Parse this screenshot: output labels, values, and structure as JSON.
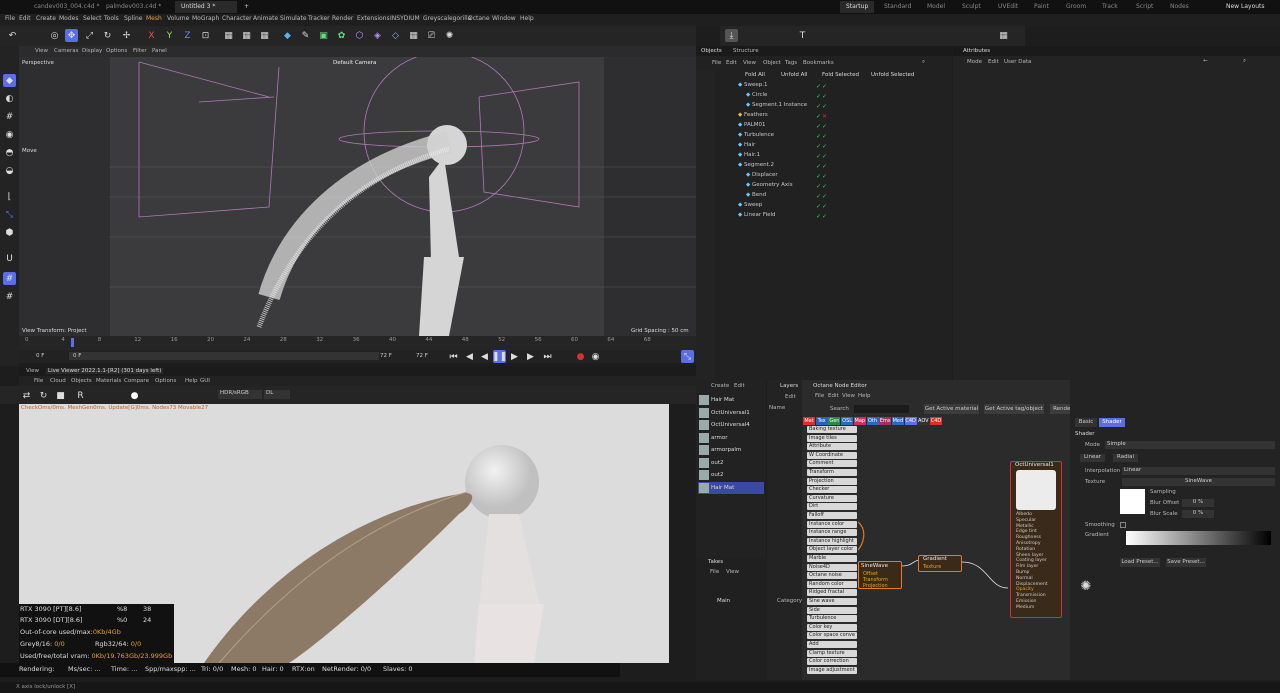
{
  "tabs": [
    "candev003_004.c4d *",
    "palmdev003.c4d *",
    "Untitled 3 *"
  ],
  "layouts": [
    "Startup",
    "Standard",
    "Model",
    "Sculpt",
    "UVEdit",
    "Paint",
    "Groom",
    "Track",
    "Script",
    "Nodes",
    "New Layouts"
  ],
  "menu": [
    "File",
    "Edit",
    "Create",
    "Modes",
    "Select",
    "Tools",
    "Spline",
    "Mesh",
    "Volume",
    "MoGraph",
    "Character",
    "Animate",
    "Simulate",
    "Tracker",
    "Render",
    "Extensions",
    "INSYDIUM",
    "Greyscalegorilla",
    "Octane",
    "Window",
    "Help"
  ],
  "viewport": {
    "menu": [
      "View",
      "Cameras",
      "Display",
      "Options",
      "Filter",
      "Panel"
    ],
    "label": "Perspective",
    "camera": "Default Camera",
    "move": "Move",
    "transform": "View Transform: Project",
    "grid": "Grid Spacing : 50 cm"
  },
  "timeline": {
    "ticks": [
      "0",
      "4",
      "8",
      "12",
      "16",
      "20",
      "24",
      "28",
      "32",
      "36",
      "40",
      "44",
      "48",
      "52",
      "56",
      "60",
      "64",
      "68"
    ],
    "start": "0 F",
    "cur": "0 F",
    "end": "72 F",
    "end2": "72 F"
  },
  "objects": {
    "tabs": [
      "Objects",
      "Structure"
    ],
    "menu": [
      "File",
      "Edit",
      "View",
      "Object",
      "Tags",
      "Bookmarks"
    ],
    "fold": [
      "Fold All",
      "Unfold All",
      "Fold Selected",
      "Unfold Selected"
    ],
    "rows": [
      "Sweep.1",
      "Circle",
      "Segment.1 Instance",
      "Feathers",
      "PALM01",
      "Turbulence",
      "Hair",
      "Hair.1",
      "Segment.2",
      "Displacer",
      "Geometry Axis",
      "Bend",
      "Sweep",
      "Linear Field"
    ]
  },
  "attributes": {
    "title": "Attributes",
    "menu": [
      "Mode",
      "Edit",
      "User Data"
    ]
  },
  "liveviewer": {
    "tabs": [
      "View",
      "Live Viewer 2022.1.1-[R2] (301 days left)"
    ],
    "menu": [
      "File",
      "Cloud",
      "Objects",
      "Materials",
      "Compare",
      "Options",
      "Help",
      "GUI"
    ],
    "colorspace": "HDR/sRGB",
    "mode": "DL",
    "info": "CheckOms/0ms. MeshGen0ms. Update[G]0ms. Nodes73 Movable27",
    "gpu": [
      {
        "n": "RTX 3090 [PT][8.6]",
        "a": "%8",
        "b": "38"
      },
      {
        "n": "RTX 3090 [DT][8.6]",
        "a": "%0",
        "b": "24"
      }
    ],
    "ooc": "Out-of-core used/max:",
    "oocv": "0Kb/4Gb",
    "grey": "Grey8/16: ",
    "greyv": "0/0",
    "rgb": "Rgb32/64: ",
    "rgbv": "0/0",
    "vram": "Used/free/total vram: ",
    "vramv": "0Kb/19.763Gb/23.999Gb",
    "status": [
      "Rendering:",
      "Ms/sec: ...",
      "Time: ...",
      "Spp/maxspp: ...",
      "Tri: 0/0",
      "Mesh: 0",
      "Hair: 0",
      "RTX:on",
      "NetRender: 0/0",
      "Slaves: 0"
    ]
  },
  "materials": [
    "Hair Mat",
    "OctUniversal1",
    "OctUniversal4",
    "armor",
    "armorpalm",
    "out2",
    "out2",
    "Hair Mat"
  ],
  "matmenu": [
    "Create",
    "Edit"
  ],
  "layers": {
    "title": "Layers",
    "menu": [
      "Edit"
    ],
    "name": "Name"
  },
  "takes": {
    "title": "Takes",
    "menu": [
      "File",
      "View"
    ],
    "main": "Main",
    "category": "Category"
  },
  "nodeed": {
    "title": "Octane Node Editor",
    "menu": [
      "File",
      "Edit",
      "View",
      "Help"
    ],
    "search": "Search",
    "buttons": [
      "Get Active material",
      "Get Active tag/object",
      "Render AOVs"
    ],
    "cats": [
      "Mat",
      "Tex",
      "Gen",
      "OSL",
      "Map",
      "Oth",
      "Ems",
      "Med",
      "C4D",
      "AOV",
      "C4D"
    ],
    "list": [
      "Baking texture",
      "Image tiles",
      "Attribute",
      "W Coordinate",
      "Comment",
      "Transform",
      "Projection",
      "Checker",
      "Curvature",
      "Dirt",
      "Falloff",
      "Instance color",
      "Instance range",
      "Instance highlight",
      "Object layer color",
      "Marble",
      "Noise4D",
      "Octane noise",
      "Random color",
      "Ridged fractal",
      "Sine wave",
      "Side",
      "Turbulence",
      "Color key",
      "Color space conve",
      "Add",
      "Clamp texture",
      "Color correction",
      "Image adjustment"
    ],
    "sinewave": "SineWave",
    "sineports": [
      "Offset",
      "Transform",
      "Projection"
    ],
    "gradient": "Gradient",
    "gradports": [
      "Texture"
    ],
    "univ": "OctUniversal1",
    "univports": [
      "Albedo",
      "Specular",
      "Metallic",
      "Edge tint",
      "Roughness",
      "Anisotropy",
      "Rotation",
      "Sheen layer",
      "Coating layer",
      "Film layer",
      "Bump",
      "Normal",
      "Displacement",
      "Opacity",
      "Transmission",
      "Emission",
      "Medium"
    ]
  },
  "shader": {
    "tabs": [
      "Basic",
      "Shader"
    ],
    "title": "Shader",
    "mode": "Mode",
    "modev": "Simple",
    "lin": "Linear",
    "rad": "Radial",
    "interp": "Interpolation",
    "interpv": "Linear",
    "texture": "Texture",
    "texturev": "SineWave",
    "sampling": "Sampling",
    "blurOff": "Blur Offset",
    "blurOffv": "0 %",
    "blurScale": "Blur Scale",
    "blurScalev": "0 %",
    "smoothing": "Smoothing",
    "gradient": "Gradient",
    "load": "Load Preset...",
    "save": "Save Preset..."
  },
  "statusbar": "X axis lock/unlock [X]",
  "colors": {
    "accent": "#5a6ee8",
    "green": "#36d26a",
    "orange": "#e8781a",
    "red": "#d83030"
  }
}
